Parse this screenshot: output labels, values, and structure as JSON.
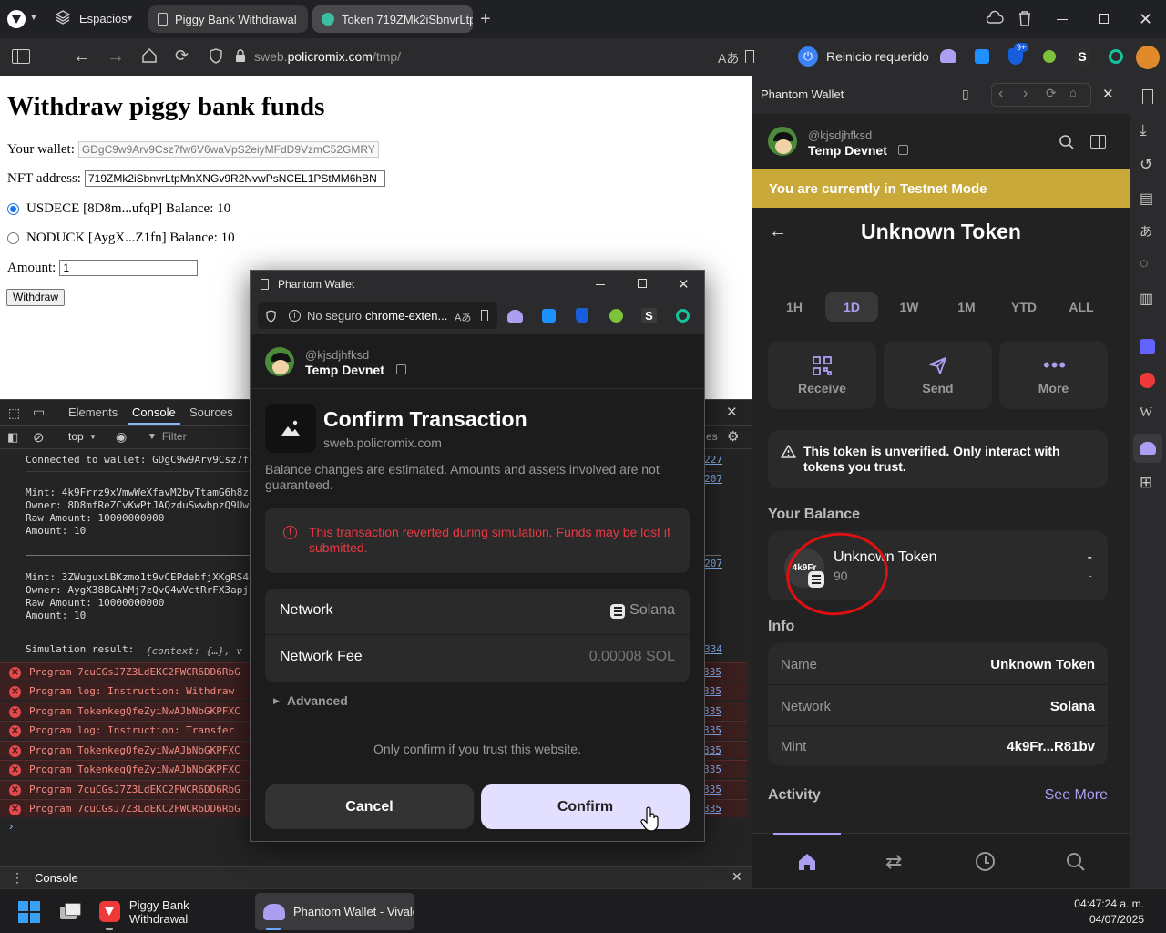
{
  "browser": {
    "spaces_label": "Espacios",
    "tabs": [
      {
        "label": "Piggy Bank Withdrawal"
      },
      {
        "label": "Token 719ZMk2iSbnvrLtpM"
      }
    ],
    "url_domain_prefix": "sweb.",
    "url_domain": "policromix.com",
    "url_path": "/tmp/",
    "restart_label": "Reinicio requerido",
    "ext_badge": "9+"
  },
  "page": {
    "title": "Withdraw piggy bank funds",
    "wallet_label": "Your wallet:",
    "wallet_value": "GDgC9w9Arv9Csz7fw6V6waVpS2eiyMFdD9VzmC52GMRY",
    "nft_label": "NFT address:",
    "nft_value": "719ZMk2iSbnvrLtpMnXNGv9R2NvwPsNCEL1PStMM6hBN",
    "options": [
      {
        "label": "USDECE [8D8m...ufqP] Balance: 10",
        "selected": true
      },
      {
        "label": "NODUCK [AygX...Z1fn] Balance: 10",
        "selected": false
      }
    ],
    "amount_label": "Amount:",
    "amount_value": "1",
    "withdraw_label": "Withdraw"
  },
  "devtools": {
    "tabs": [
      "Elements",
      "Console",
      "Sources"
    ],
    "active_tab": "Console",
    "context": "top",
    "filter_placeholder": "Filter",
    "lines": [
      {
        "text": "Connected to wallet: GDgC9w9Arv9Csz7f",
        "link": "227"
      },
      {
        "text": "Mint: 4k9Frrz9xVmwWeXfavM2byTtamG6h8z",
        "link": "207"
      },
      {
        "text": "Owner: 8D8mfReZCvKwPtJAQzduSwwbpzQ9Uw",
        "link": ""
      },
      {
        "text": "Raw Amount: 10000000000",
        "link": ""
      },
      {
        "text": "Amount: 10",
        "link": ""
      },
      {
        "text": "Mint: 3ZWuguxLBKzmo1t9vCEPdebfjXKgRS4",
        "link": "207"
      },
      {
        "text": "Owner: AygX38BGAhMj7zQvQ4wVctRrFX3apj",
        "link": ""
      },
      {
        "text": "Raw Amount: 10000000000",
        "link": ""
      },
      {
        "text": "Amount: 10",
        "link": ""
      }
    ],
    "sim_label": "Simulation result:",
    "sim_value": "{context: {…}, v",
    "sim_link": "334",
    "errors": [
      {
        "text": "Program 7cuCGsJ7Z3LdEKC2FWCR6DD6RbG",
        "link": "335"
      },
      {
        "text": "Program log: Instruction: Withdraw",
        "link": "335"
      },
      {
        "text": "Program TokenkegQfeZyiNwAJbNbGKPFXC",
        "link": "335"
      },
      {
        "text": "Program log: Instruction: Transfer",
        "link": "335"
      },
      {
        "text": "Program TokenkegQfeZyiNwAJbNbGKPFXC",
        "link": "335"
      },
      {
        "text": "Program TokenkegQfeZyiNwAJbNbGKPFXC",
        "link": "335"
      },
      {
        "text": "Program 7cuCGsJ7Z3LdEKC2FWCR6DD6RbG",
        "link": "335"
      },
      {
        "text": "Program 7cuCGsJ7Z3LdEKC2FWCR6DD6RbG",
        "link": "335"
      }
    ],
    "res_label": "es",
    "drawer_tab": "Console"
  },
  "popup": {
    "window_title": "Phantom Wallet",
    "not_secure": "No seguro",
    "url": "chrome-exten...",
    "username": "@kjsdjhfksd",
    "account": "Temp Devnet",
    "heading": "Confirm Transaction",
    "origin": "sweb.policromix.com",
    "estimate_note": "Balance changes are estimated. Amounts and assets involved are not guaranteed.",
    "error_text": "This transaction reverted during simulation. Funds may be lost if submitted.",
    "network_label": "Network",
    "network_value": "Solana",
    "fee_label": "Network Fee",
    "fee_value": "0.00008 SOL",
    "advanced_label": "Advanced",
    "trust_note": "Only confirm if you trust this website.",
    "cancel_label": "Cancel",
    "confirm_label": "Confirm"
  },
  "side": {
    "panel_title": "Phantom Wallet",
    "username": "@kjsdjhfksd",
    "account": "Temp Devnet",
    "testnet_banner": "You are currently in Testnet Mode",
    "token_title": "Unknown Token",
    "ranges": [
      "1H",
      "1D",
      "1W",
      "1M",
      "YTD",
      "ALL"
    ],
    "active_range": "1D",
    "actions": [
      {
        "label": "Receive",
        "icon": "qr-icon"
      },
      {
        "label": "Send",
        "icon": "send-icon"
      },
      {
        "label": "More",
        "icon": "more-icon"
      }
    ],
    "warning": "This token is unverified. Only interact with tokens you trust.",
    "balance_heading": "Your Balance",
    "token_logo_text": "4k9Fr",
    "balance_name": "Unknown Token",
    "balance_amount": "90",
    "balance_value": "-",
    "balance_change": "-",
    "info_heading": "Info",
    "info": [
      {
        "label": "Name",
        "value": "Unknown Token"
      },
      {
        "label": "Network",
        "value": "Solana"
      },
      {
        "label": "Mint",
        "value": "4k9Fr...R81bv"
      }
    ],
    "activity_heading": "Activity",
    "see_more": "See More",
    "accent": "#ab9ff2",
    "banner_color": "#c8a93a"
  },
  "taskbar": {
    "items": [
      {
        "label": "Piggy Bank Withdrawal"
      },
      {
        "label": "Phantom Wallet - Vivalc"
      }
    ],
    "time": "04:47:24 a. m.",
    "date": "04/07/2025"
  }
}
